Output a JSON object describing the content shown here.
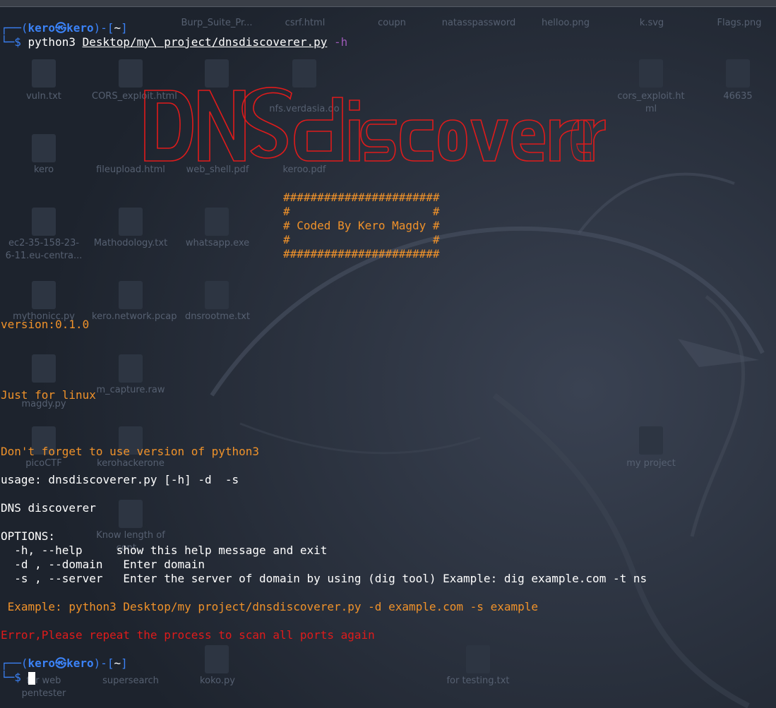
{
  "desktop": {
    "icons": [
      {
        "label": "Burp_Suite_Pr..."
      },
      {
        "label": "csrf.html"
      },
      {
        "label": "coupn"
      },
      {
        "label": "natasspassword"
      },
      {
        "label": "helloo.png"
      },
      {
        "label": "k.svg"
      },
      {
        "label": "Flags.png"
      },
      {
        "label": "vuln.txt"
      },
      {
        "label": "CORS_exploit.html"
      },
      {
        "label": "nfs.verdasia.do"
      },
      {
        "label": "cors_exploit.ht ml"
      },
      {
        "label": "46635"
      },
      {
        "label": "kero"
      },
      {
        "label": "fileupload.html"
      },
      {
        "label": "web_shell.pdf"
      },
      {
        "label": "keroo.pdf"
      },
      {
        "label": "ec2-35-158-23-6-11.eu-centra..."
      },
      {
        "label": "Mathodology.txt"
      },
      {
        "label": "whatsapp.exe"
      },
      {
        "label": "mythonicc.py"
      },
      {
        "label": "kero.network.pcap"
      },
      {
        "label": "dnsrootme.txt"
      },
      {
        "label": "magdy.py"
      },
      {
        "label": "m_capture.raw"
      },
      {
        "label": "picoCTF"
      },
      {
        "label": "kerohackerone"
      },
      {
        "label": "my project"
      },
      {
        "label": "Know length of cont..."
      },
      {
        "label": "for web pentester"
      },
      {
        "label": "supersearch"
      },
      {
        "label": "koko.py"
      },
      {
        "label": "for testing.txt"
      }
    ]
  },
  "terminal": {
    "prompt1": {
      "open": "┌──(",
      "user": "kero㉿kero",
      "mid": ")-[",
      "dir": "~",
      "close": "]",
      "prefix": "└─",
      "dollar": "$ ",
      "command": "python3 ",
      "path": "Desktop/my\\ project/dnsdiscoverer.py",
      "flag": " -h"
    },
    "banner_art": "DNSdiscoverer",
    "hash_box": [
      "#######################",
      "#                     #",
      "# Coded By Kero Magdy #",
      "#                     #",
      "#######################"
    ],
    "version": "version:0.1.0",
    "linux_note": "Just for linux",
    "python_note": "Don't forget to use version of python3",
    "usage": "usage: dnsdiscoverer.py [-h] -d  -s",
    "description": "DNS discoverer",
    "options_header": "OPTIONS:",
    "options": [
      "  -h, --help     show this help message and exit",
      "  -d , --domain   Enter domain",
      "  -s , --server   Enter the server of domain by using (dig tool) Example: dig example.com -t ns"
    ],
    "example": " Example: python3 Desktop/my project/dnsdiscoverer.py -d example.com -s example",
    "error": "Error,Please repeat the process to scan all ports again",
    "prompt2": {
      "open": "┌──(",
      "user": "kero㉿kero",
      "mid": ")-[",
      "dir": "~",
      "close": "]",
      "prefix": "└─",
      "dollar": "$ "
    }
  },
  "colors": {
    "background": "#202733",
    "prompt_blue": "#3b82f6",
    "orange": "#f0922a",
    "red": "#e01b1b",
    "flag_purple": "#9b59b6"
  }
}
